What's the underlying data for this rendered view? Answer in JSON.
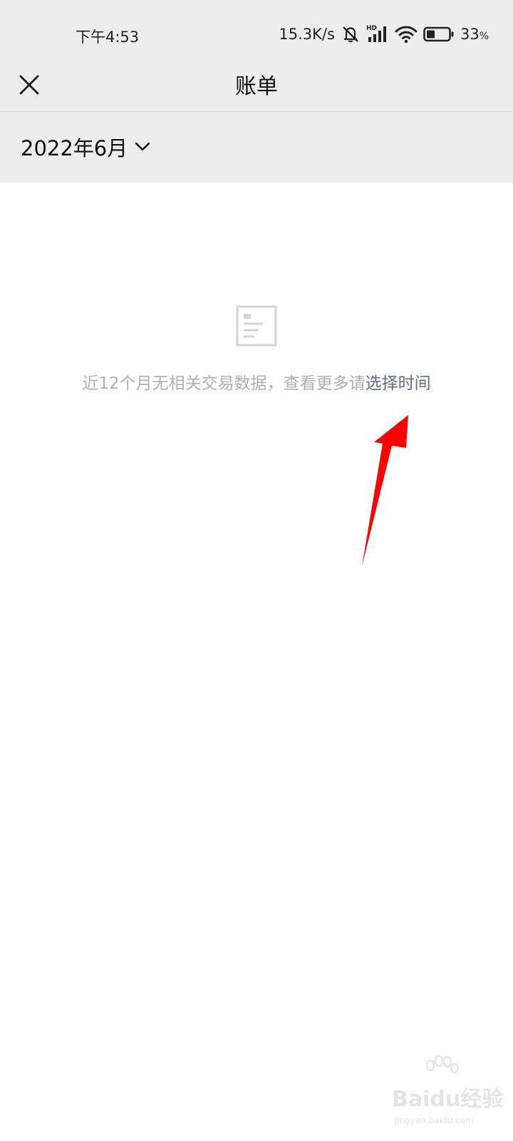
{
  "status_bar": {
    "time": "下午4:53",
    "network_speed": "15.3K/s",
    "battery_percent": "33",
    "battery_unit": "%",
    "icons": [
      "mute-icon",
      "hd-signal-icon",
      "wifi-icon",
      "battery-icon"
    ]
  },
  "header": {
    "title": "账单",
    "close_icon": "close-icon"
  },
  "month_selector": {
    "label": "2022年6月",
    "icon": "chevron-down-icon"
  },
  "empty_state": {
    "icon": "document-icon",
    "message": "近12个月无相关交易数据，查看更多请",
    "link_text": "选择时间",
    "link_color": "#5b6d8f"
  },
  "annotation": {
    "arrow_color": "#ff0000"
  },
  "watermark": {
    "brand": "Baidu经验",
    "url": "jingyan.baidu.com"
  }
}
